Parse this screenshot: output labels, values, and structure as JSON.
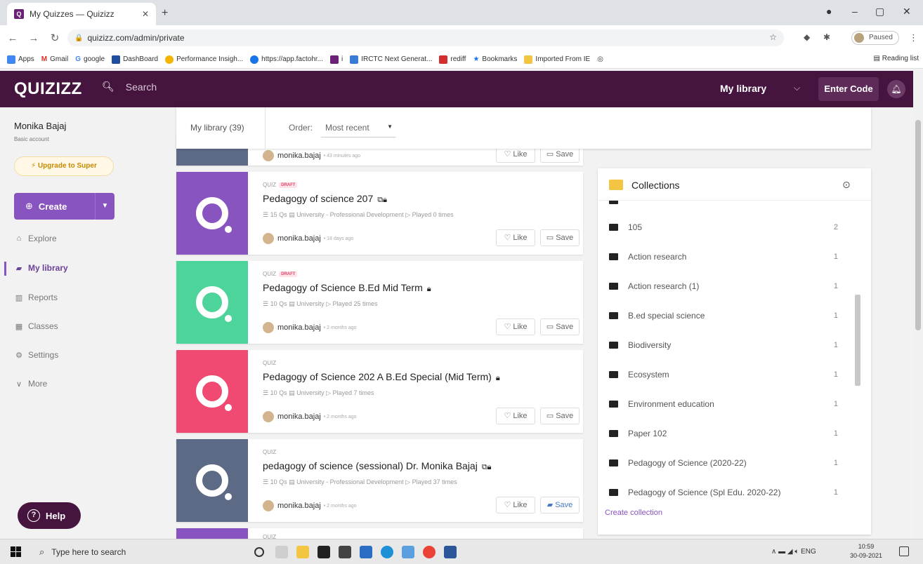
{
  "browser": {
    "tab_title": "My Quizzes — Quizizz",
    "url": "quizizz.com/admin/private",
    "profile_status": "Paused",
    "bookmarks": [
      "Apps",
      "Gmail",
      "google",
      "DashBoard",
      "Performance Insigh...",
      "https://app.factohr...",
      "i",
      "IRCTC Next Generat...",
      "rediff",
      "Bookmarks",
      "Imported From IE"
    ],
    "reading_list": "Reading list"
  },
  "header": {
    "logo": "QUIZIZZ",
    "search_placeholder": "Search",
    "library_menu": "My library",
    "enter_code": "Enter Code"
  },
  "sidebar": {
    "user_name": "Monika Bajaj",
    "account_type": "Basic account",
    "upgrade": "Upgrade to Super",
    "create": "Create",
    "nav": [
      "Explore",
      "My library",
      "Reports",
      "Classes",
      "Settings",
      "More"
    ],
    "help": "Help"
  },
  "filter": {
    "library_label": "My library (39)",
    "order_label": "Order:",
    "order_value": "Most recent"
  },
  "partial_card": {
    "author": "monika.bajaj",
    "ago": "• 43 minutes ago",
    "like": "Like",
    "save": "Save"
  },
  "cards": [
    {
      "type": "QUIZ",
      "draft": "DRAFT",
      "title": "Pedagogy of science 207",
      "meta": "☰ 15 Qs   ▤ University - Professional Development   ▷ Played 0 times",
      "author": "monika.bajaj",
      "ago": "• 18 days ago",
      "like": "Like",
      "save": "Save",
      "color": "#8854c0"
    },
    {
      "type": "QUIZ",
      "draft": "DRAFT",
      "title": "Pedagogy of Science B.Ed Mid Term",
      "meta": "☰ 10 Qs   ▤ University   ▷ Played 25 times",
      "author": "monika.bajaj",
      "ago": "• 2 months ago",
      "like": "Like",
      "save": "Save",
      "color": "#4dd49a"
    },
    {
      "type": "QUIZ",
      "draft": "",
      "title": "Pedagogy of Science 202 A B.Ed Special (Mid Term)",
      "meta": "☰ 10 Qs   ▤ University   ▷ Played 7 times",
      "author": "monika.bajaj",
      "ago": "• 2 months ago",
      "like": "Like",
      "save": "Save",
      "color": "#f04a73"
    },
    {
      "type": "QUIZ",
      "draft": "",
      "title": "pedagogy of science (sessional) Dr. Monika Bajaj",
      "meta": "☰ 10 Qs   ▤ University - Professional Development   ▷ Played 37 times",
      "author": "monika.bajaj",
      "ago": "• 2 months ago",
      "like": "Like",
      "save": "Save",
      "color": "#5d6a85"
    }
  ],
  "next_card_type": "QUIZ",
  "collections": {
    "title": "Collections",
    "items": [
      {
        "name": "105",
        "count": "2"
      },
      {
        "name": "Action research",
        "count": "1"
      },
      {
        "name": "Action research (1)",
        "count": "1"
      },
      {
        "name": "B.ed special science",
        "count": "1"
      },
      {
        "name": "Biodiversity",
        "count": "1"
      },
      {
        "name": "Ecosystem",
        "count": "1"
      },
      {
        "name": "Environment education",
        "count": "1"
      },
      {
        "name": "Paper 102",
        "count": "1"
      },
      {
        "name": "Pedagogy of Science (2020-22)",
        "count": "1"
      },
      {
        "name": "Pedagogy of Science (Spl Edu. 2020-22)",
        "count": "1"
      }
    ],
    "create": "Create collection"
  },
  "taskbar": {
    "search_placeholder": "Type here to search",
    "language": "ENG",
    "time": "10:59",
    "date": "30-09-2021"
  }
}
